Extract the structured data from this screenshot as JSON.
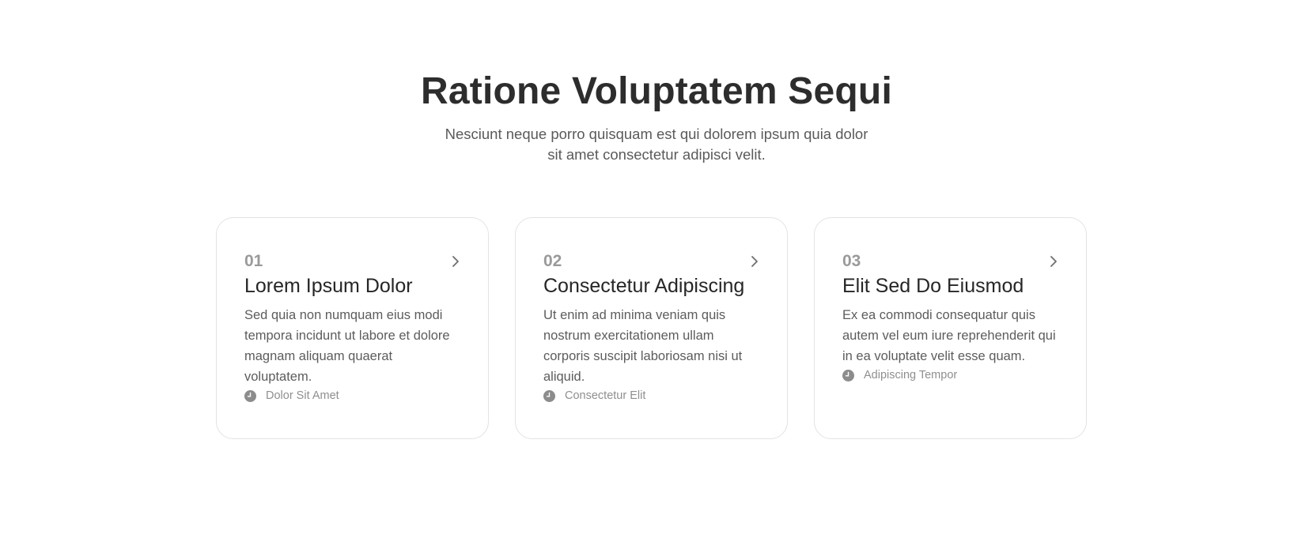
{
  "header": {
    "title": "Ratione Voluptatem Sequi",
    "subtitle": "Nesciunt neque porro quisquam est qui dolorem ipsum quia dolor sit amet consectetur adipisci velit."
  },
  "cards": [
    {
      "number": "01",
      "title": "Lorem Ipsum Dolor",
      "description": "Sed quia non numquam eius modi tempora incidunt ut labore et dolore magnam aliquam quaerat voluptatem.",
      "meta": "Dolor Sit Amet",
      "meta_icon": "clock-icon",
      "action_icon": "chevron-right-icon"
    },
    {
      "number": "02",
      "title": "Consectetur Adipiscing",
      "description": "Ut enim ad minima veniam quis nostrum exercitationem ullam corporis suscipit laboriosam nisi ut aliquid.",
      "meta": "Consectetur Elit",
      "meta_icon": "clock-icon",
      "action_icon": "chevron-right-icon"
    },
    {
      "number": "03",
      "title": "Elit Sed Do Eiusmod",
      "description": "Ex ea commodi consequatur quis autem vel eum iure reprehenderit qui in ea voluptate velit esse quam.",
      "meta": "Adipiscing Tempor",
      "meta_icon": "clock-icon",
      "action_icon": "chevron-right-icon"
    }
  ],
  "colors": {
    "title": "#2d2d2d",
    "body_text": "#5c5c5c",
    "muted": "#9a9a9a",
    "card_border": "#e3e3e3",
    "background": "#ffffff"
  }
}
